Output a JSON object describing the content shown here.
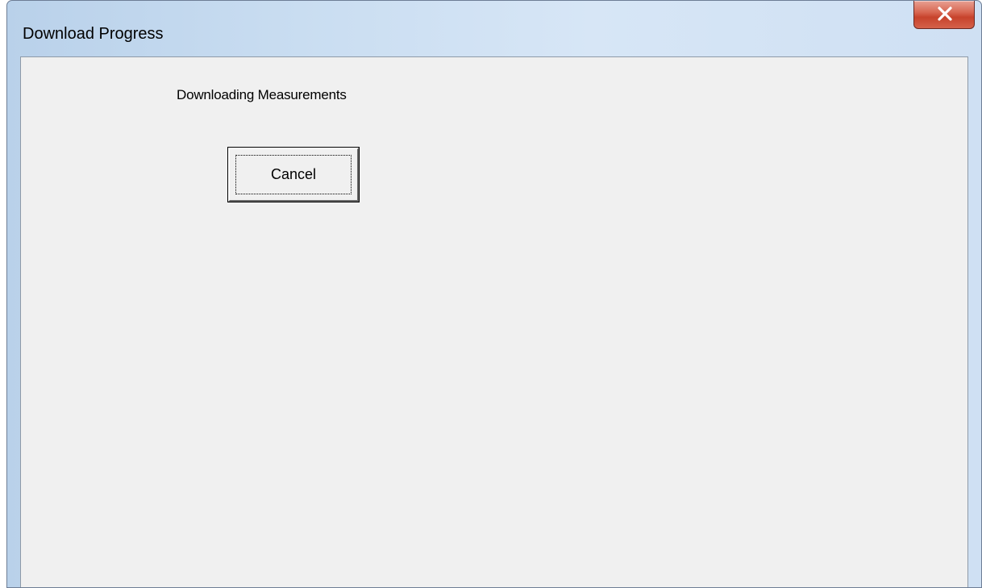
{
  "window": {
    "title": "Download Progress"
  },
  "dialog": {
    "status_text": "Downloading Measurements",
    "cancel_label": "Cancel"
  },
  "icons": {
    "close": "close-icon"
  },
  "colors": {
    "client_background": "#f0f0f0",
    "close_button": "#c7432c",
    "titlebar": "#c9ddf1"
  }
}
